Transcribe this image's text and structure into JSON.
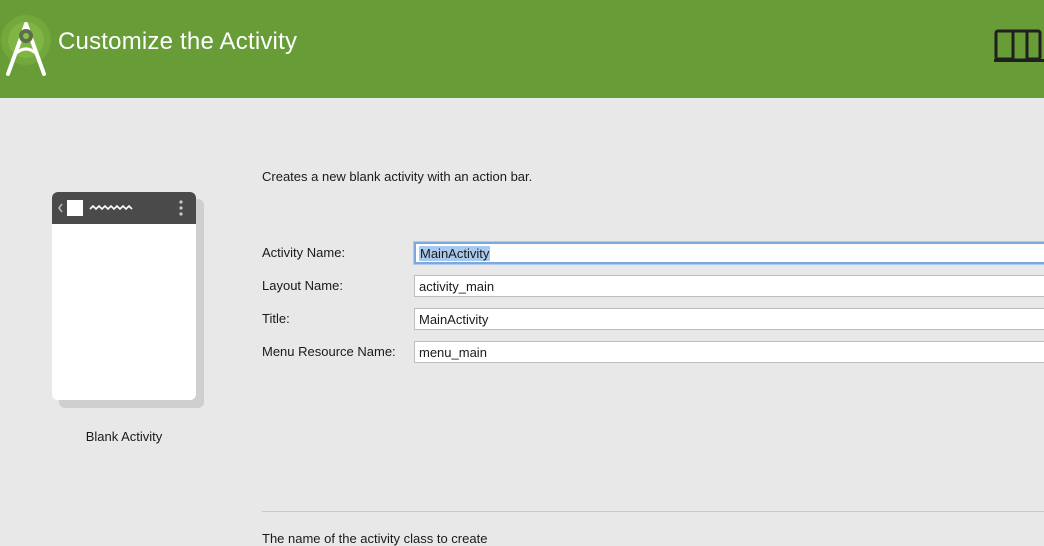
{
  "header": {
    "title": "Customize the Activity",
    "background_color": "#679c37",
    "logo_icon": "android-studio-logo-icon",
    "device_icon": "device-form-factors-icon"
  },
  "template": {
    "name": "Blank Activity",
    "description": "Creates a new blank activity with an action bar."
  },
  "form": {
    "fields": [
      {
        "label": "Activity Name:",
        "value": "MainActivity",
        "focused": true,
        "selected": true
      },
      {
        "label": "Layout Name:",
        "value": "activity_main"
      },
      {
        "label": "Title:",
        "value": "MainActivity"
      },
      {
        "label": "Menu Resource Name:",
        "value": "menu_main"
      }
    ]
  },
  "help": {
    "text": "The name of the activity class to create"
  }
}
